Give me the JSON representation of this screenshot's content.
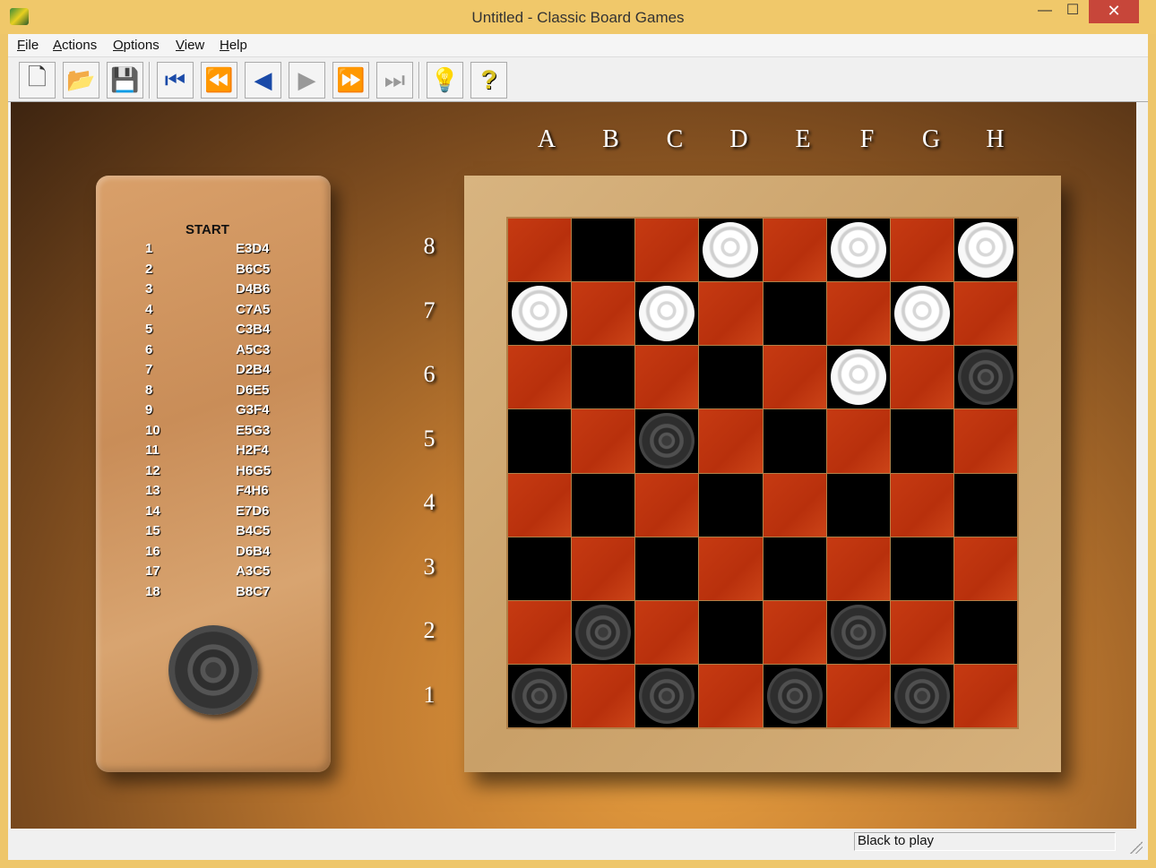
{
  "window": {
    "title": "Untitled - Classic Board Games",
    "min": "—",
    "max": "☐",
    "close": "✕"
  },
  "menu": [
    "File",
    "Actions",
    "Options",
    "View",
    "Help"
  ],
  "toolbar": [
    {
      "name": "new-icon",
      "glyph": "🗋",
      "color": "#333"
    },
    {
      "name": "open-icon",
      "glyph": "📂",
      "color": "#5a8a2a"
    },
    {
      "name": "save-icon",
      "glyph": "💾",
      "color": "#8a7a10"
    },
    {
      "name": "first-move-icon",
      "glyph": "⏮",
      "color": "#1a4aa8"
    },
    {
      "name": "rewind-icon",
      "glyph": "⏪",
      "color": "#1a4aa8"
    },
    {
      "name": "back-icon",
      "glyph": "◀",
      "color": "#1a4aa8"
    },
    {
      "name": "forward-icon",
      "glyph": "▶",
      "color": "#999"
    },
    {
      "name": "fast-forward-icon",
      "glyph": "⏩",
      "color": "#999"
    },
    {
      "name": "last-move-icon",
      "glyph": "⏭",
      "color": "#999"
    },
    {
      "name": "hint-bulb-icon",
      "glyph": "💡",
      "color": "#30b0d0"
    },
    {
      "name": "help-icon",
      "glyph": "?",
      "color": "#d8c020"
    }
  ],
  "moves": {
    "header": "START",
    "list": [
      [
        "1",
        "E3D4"
      ],
      [
        "2",
        "B6C5"
      ],
      [
        "3",
        "D4B6"
      ],
      [
        "4",
        "C7A5"
      ],
      [
        "5",
        "C3B4"
      ],
      [
        "6",
        "A5C3"
      ],
      [
        "7",
        "D2B4"
      ],
      [
        "8",
        "D6E5"
      ],
      [
        "9",
        "G3F4"
      ],
      [
        "10",
        "E5G3"
      ],
      [
        "11",
        "H2F4"
      ],
      [
        "12",
        "H6G5"
      ],
      [
        "13",
        "F4H6"
      ],
      [
        "14",
        "E7D6"
      ],
      [
        "15",
        "B4C5"
      ],
      [
        "16",
        "D6B4"
      ],
      [
        "17",
        "A3C5"
      ],
      [
        "18",
        "B8C7"
      ]
    ]
  },
  "board": {
    "files": [
      "A",
      "B",
      "C",
      "D",
      "E",
      "F",
      "G",
      "H"
    ],
    "ranks": [
      "8",
      "7",
      "6",
      "5",
      "4",
      "3",
      "2",
      "1"
    ],
    "rows": [
      "...w.w.w",
      "w.w...w.",
      ".....w.b",
      "..b.....",
      "........",
      "........",
      ".b...b..",
      "b.b.b.b."
    ]
  },
  "status": "Black to play"
}
